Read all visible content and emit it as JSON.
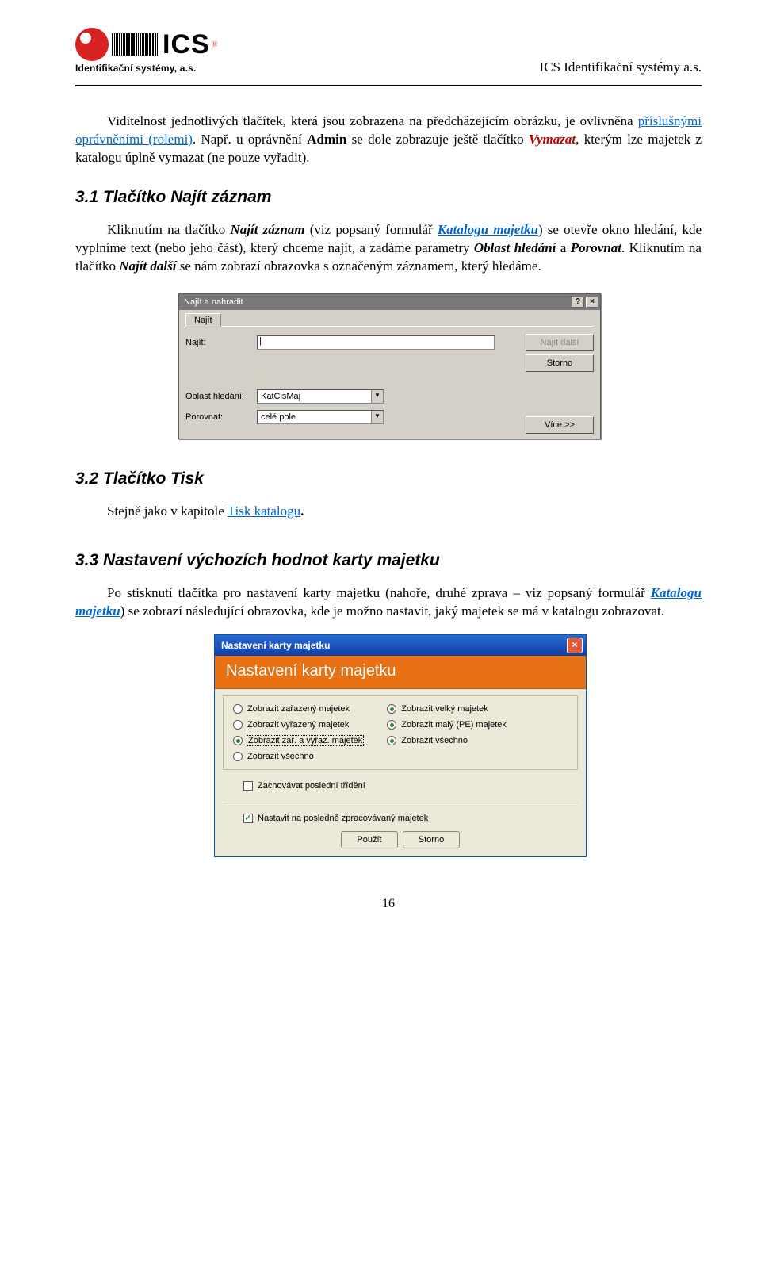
{
  "header": {
    "logo_text": "ICS",
    "reg_mark": "®",
    "logo_sub": "Identifikační systémy, a.s.",
    "right_text": "ICS Identifikační systémy a.s."
  },
  "body": {
    "p1_a": "Viditelnost jednotlivých tlačítek, která jsou zobrazena na předcházejícím obrázku, je ovlivněna ",
    "p1_link": "příslušnými oprávněními (rolemi)",
    "p1_b": ". Např. u oprávnění ",
    "p1_admin": "Admin",
    "p1_c": " se dole zobrazuje ještě tlačítko ",
    "p1_vymazat": "Vymazat",
    "p1_d": ", kterým lze majetek z katalogu úplně vymazat (ne pouze vyřadit)."
  },
  "s31": {
    "heading": "3.1  Tlačítko Najít záznam",
    "p_a": "Kliknutím na tlačítko ",
    "p_b": "Najít záznam",
    "p_c": " (viz popsaný formulář ",
    "p_link": "Katalogu majetku",
    "p_d": ") se otevře okno hledání, kde vyplníme text (nebo jeho část), který chceme najít, a zadáme parametry ",
    "p_e": "Oblast hledání",
    "p_f": " a ",
    "p_g": "Porovnat",
    "p_h": ". Kliknutím na tlačítko ",
    "p_i": "Najít další",
    "p_j": " se nám zobrazí obrazovka s označeným záznamem, který hledáme."
  },
  "dlg1": {
    "title": "Najít a nahradit",
    "help_btn": "?",
    "close_btn": "×",
    "tab": "Najít",
    "lbl_find": "Najít:",
    "input_find": "",
    "lbl_area": "Oblast hledání:",
    "combo_area": "KatCisMaj",
    "lbl_compare": "Porovnat:",
    "combo_compare": "celé pole",
    "btn_findnext": "Najít další",
    "btn_cancel": "Storno",
    "btn_more": "Více >>"
  },
  "s32": {
    "heading": "3.2  Tlačítko Tisk",
    "p_a": "Stejně jako v kapitole ",
    "p_link": "Tisk katalogu",
    "p_b": "."
  },
  "s33": {
    "heading": "3.3  Nastavení výchozích hodnot karty majetku",
    "p_a": "Po stisknutí tlačítka pro nastavení karty majetku (nahoře, druhé zprava – viz popsaný formulář ",
    "p_link": "Katalogu majetku",
    "p_b": ") se zobrazí následující obrazovka, kde je možno nastavit, jaký majetek se má v katalogu zobrazovat."
  },
  "dlg2": {
    "title": "Nastavení karty majetku",
    "orange": "Nastavení karty majetku",
    "left": {
      "r1": "Zobrazit zařazený majetek",
      "r2": "Zobrazit vyřazený majetek",
      "r3": "Zobrazit zař. a vyřaz. majetek",
      "r4": "Zobrazit všechno"
    },
    "right": {
      "r1": "Zobrazit velký majetek",
      "r2": "Zobrazit malý (PE) majetek",
      "r3": "Zobrazit všechno"
    },
    "check1": "Zachovávat poslední třídění",
    "check2": "Nastavit na posledně zpracovávaný majetek",
    "btn_apply": "Použít",
    "btn_cancel": "Storno"
  },
  "page_number": "16"
}
